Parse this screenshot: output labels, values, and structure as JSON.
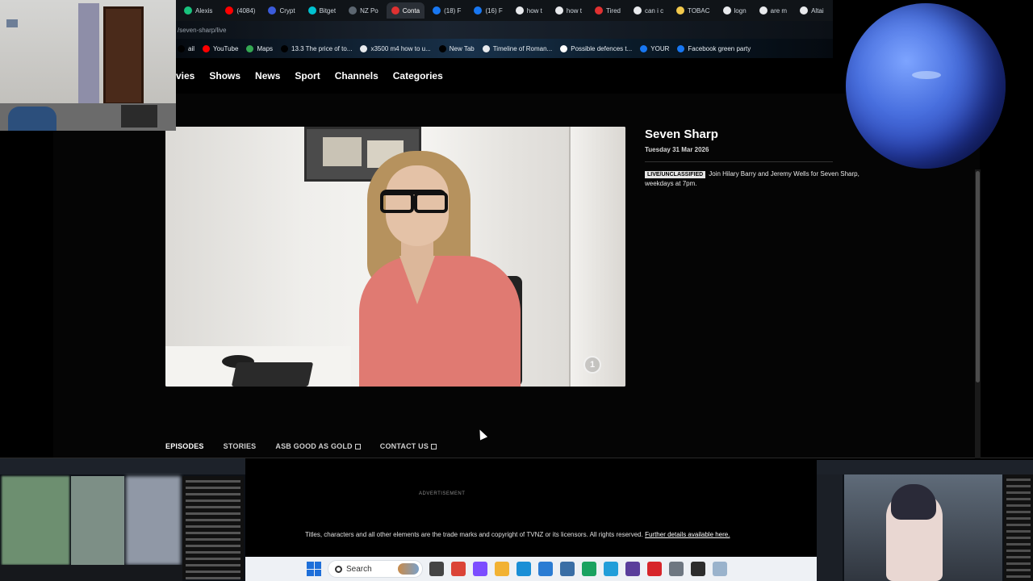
{
  "browser": {
    "tabs": [
      {
        "label": "Alexis",
        "color": "#19c37d"
      },
      {
        "label": "(4084)",
        "color": "#ff0000"
      },
      {
        "label": "Crypt",
        "color": "#3b5bdb"
      },
      {
        "label": "Bitget",
        "color": "#00c2d1"
      },
      {
        "label": "NZ Po",
        "color": "#5c6670"
      },
      {
        "label": "Conta",
        "color": "#e03131",
        "active": true
      },
      {
        "label": "(18) F",
        "color": "#1877f2"
      },
      {
        "label": "(16) F",
        "color": "#1877f2"
      },
      {
        "label": "how t",
        "color": "#e8eaed"
      },
      {
        "label": "how t",
        "color": "#e8eaed"
      },
      {
        "label": "Tired",
        "color": "#e03131"
      },
      {
        "label": "can i c",
        "color": "#e8eaed"
      },
      {
        "label": "TOBAC",
        "color": "#f2c94c"
      },
      {
        "label": "logn",
        "color": "#e8eaed"
      },
      {
        "label": "are m",
        "color": "#e8eaed"
      },
      {
        "label": "Altai",
        "color": "#e8eaed"
      }
    ],
    "new_tab_symbol": "+",
    "url": "/seven-sharp/live",
    "bookmarks": [
      {
        "label": "ail",
        "color": "#000000"
      },
      {
        "label": "YouTube",
        "color": "#ff0000"
      },
      {
        "label": "Maps",
        "color": "#34a853"
      },
      {
        "label": "13.3 The price of to...",
        "color": "#000000"
      },
      {
        "label": "x3500 m4 how to u...",
        "color": "#e8eaed"
      },
      {
        "label": "New Tab",
        "color": "#000000"
      },
      {
        "label": "Timeline of Roman...",
        "color": "#e8eaed"
      },
      {
        "label": "Possible defences t...",
        "color": "#ffffff"
      },
      {
        "label": "YOUR",
        "color": "#1877f2"
      },
      {
        "label": "Facebook green party",
        "color": "#1877f2"
      }
    ]
  },
  "site_nav": [
    "vies",
    "Shows",
    "News",
    "Sport",
    "Channels",
    "Categories"
  ],
  "video": {
    "badge": "1"
  },
  "show": {
    "title": "Seven Sharp",
    "date": "Tuesday 31 Mar 2026",
    "rating": "LIVE/UNCLASSIFIED",
    "description": "Join Hilary Barry and Jeremy Wells for Seven Sharp, weekdays at 7pm."
  },
  "page_tabs": [
    {
      "label": "EPISODES",
      "active": true,
      "external": false
    },
    {
      "label": "STORIES",
      "active": false,
      "external": false
    },
    {
      "label": "ASB GOOD AS GOLD",
      "active": false,
      "external": true
    },
    {
      "label": "CONTACT US",
      "active": false,
      "external": true
    }
  ],
  "footer": {
    "advertisement": "ADVERTISEMENT",
    "copyright": "Titles, characters and all other elements are the trade marks and copyright of TVNZ or its licensors. All rights reserved.",
    "link": "Further details available here."
  },
  "taskbar": {
    "search_placeholder": "Search",
    "apps": [
      {
        "name": "task-view",
        "color": "#444444"
      },
      {
        "name": "chrome",
        "color": "#db4437"
      },
      {
        "name": "copilot",
        "color": "#7c4dff"
      },
      {
        "name": "file-explorer",
        "color": "#f2b233"
      },
      {
        "name": "edge",
        "color": "#1a8fd6"
      },
      {
        "name": "weather",
        "color": "#2b7cd3"
      },
      {
        "name": "store",
        "color": "#3a6ea5"
      },
      {
        "name": "terminal",
        "color": "#1aa260"
      },
      {
        "name": "telegram",
        "color": "#229ed9"
      },
      {
        "name": "obs",
        "color": "#5a3e9b"
      },
      {
        "name": "acrobat",
        "color": "#d7262b"
      },
      {
        "name": "settings",
        "color": "#6e7781"
      },
      {
        "name": "app-dark",
        "color": "#2d2d2d"
      },
      {
        "name": "app-light",
        "color": "#9ab3cc"
      }
    ]
  }
}
